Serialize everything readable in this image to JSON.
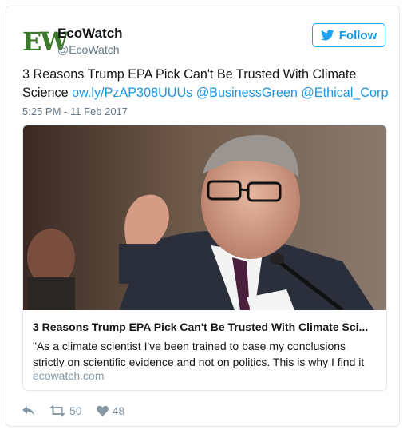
{
  "account": {
    "logo_text": "EW",
    "name": "EcoWatch",
    "handle": "@EcoWatch"
  },
  "follow": {
    "label": "Follow",
    "icon": "twitter-bird-icon"
  },
  "tweet": {
    "text_plain": "3 Reasons Trump EPA Pick Can't Be Trusted With Climate Science",
    "link": "ow.ly/PzAP308UUUs",
    "mentions": [
      "@BusinessGreen",
      "@Ethical_Corp"
    ],
    "timestamp": "5:25 PM - 11 Feb 2017"
  },
  "card": {
    "title": "3 Reasons Trump EPA Pick Can't Be Trusted With Climate Sci...",
    "description": "\"As a climate scientist I've been trained to base my conclusions strictly on scientific evidence and not on politics. This is why I find it",
    "domain": "ecowatch.com"
  },
  "actions": {
    "reply_icon": "reply-icon",
    "retweet_icon": "retweet-icon",
    "retweet_count": "50",
    "like_icon": "heart-icon",
    "like_count": "48"
  },
  "colors": {
    "link": "#1b95e0",
    "brand_green": "#3d7a2b",
    "muted": "#657786",
    "border": "#e1e8ed"
  }
}
